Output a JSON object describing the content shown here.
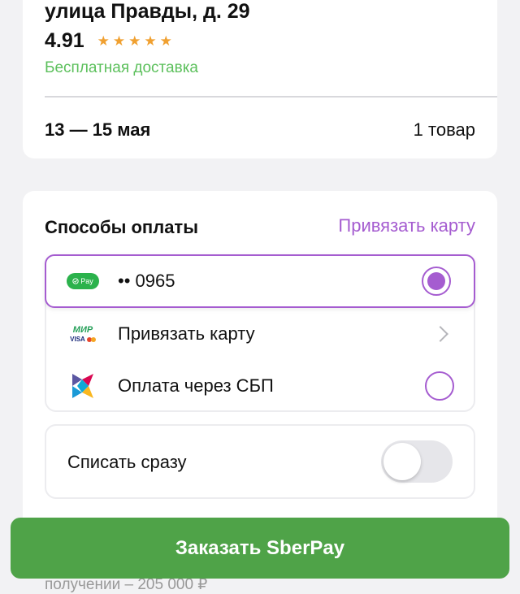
{
  "delivery": {
    "address": "улица Правды, д. 29",
    "rating": "4.91",
    "stars": "★★★★★",
    "free_delivery": "Бесплатная доставка",
    "dates": "13 — 15 мая",
    "items_count": "1 товар"
  },
  "payment": {
    "title": "Способы оплаты",
    "link_card": "Привязать карту",
    "methods": [
      {
        "label": "•• 0965",
        "icon": "sberpay-icon",
        "badge": "Pay",
        "selected": true
      },
      {
        "label": "Привязать карту",
        "icon": "mir-visa-mastercard-icon",
        "mir": "МИР",
        "visa": "VISA"
      },
      {
        "label": "Оплата через СБП",
        "icon": "sbp-icon",
        "selected": false
      }
    ],
    "write_off": {
      "label": "Списать сразу",
      "enabled": false
    }
  },
  "footer": {
    "order_button": "Заказать SberPay",
    "below_text": "получении – 205 000 ₽"
  },
  "colors": {
    "accent": "#a55cd0",
    "green": "#4fa348",
    "free": "#5cc05c",
    "stars": "#f0a030"
  }
}
